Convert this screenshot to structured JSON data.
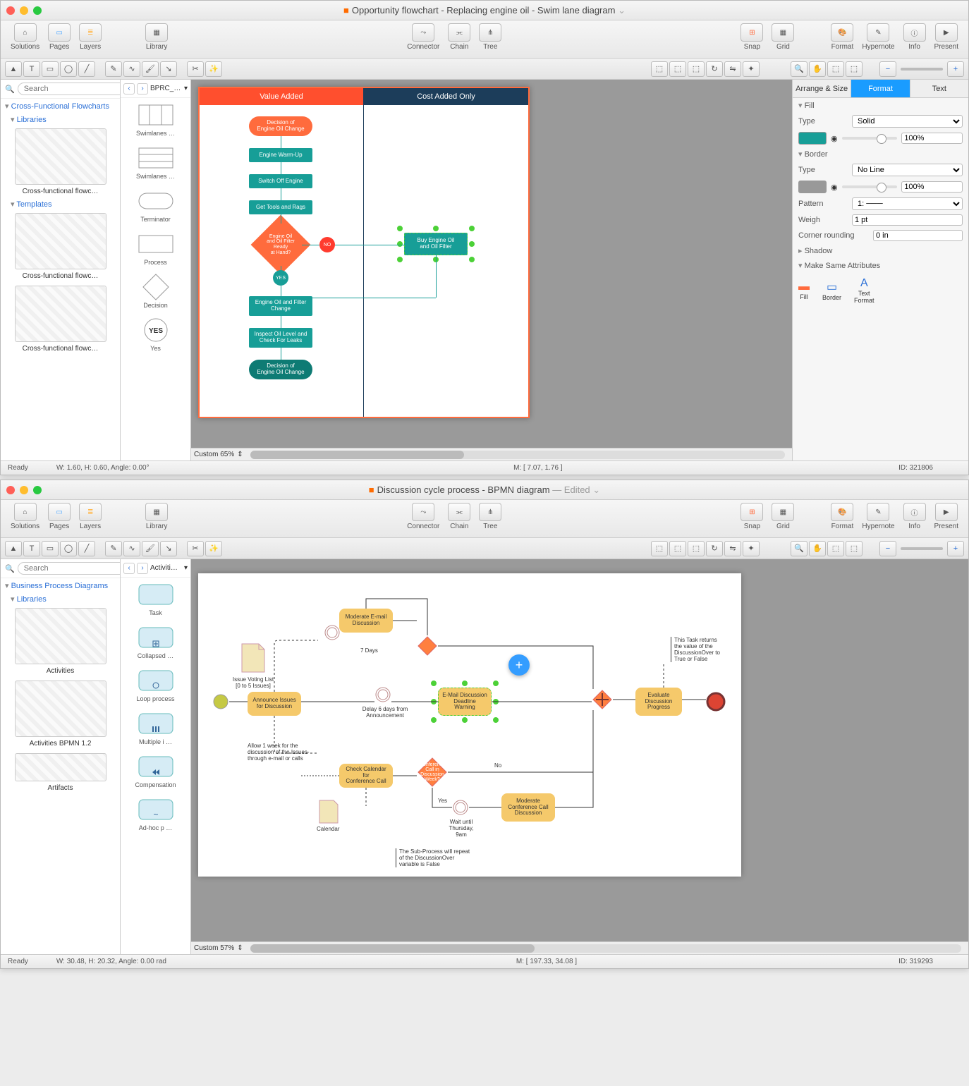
{
  "win1": {
    "title": "Opportunity flowchart - Replacing engine oil - Swim lane diagram",
    "toolbar": [
      "Solutions",
      "Pages",
      "Layers",
      "Library",
      "Connector",
      "Chain",
      "Tree",
      "Snap",
      "Grid",
      "Format",
      "Hypernote",
      "Info",
      "Present"
    ],
    "search_ph": "Search",
    "sidebar": {
      "section": "Cross-Functional Flowcharts",
      "libs": "Libraries",
      "tmpls": "Templates",
      "items": [
        "Cross-functional flowc…",
        "Cross-functional flowc…",
        "Cross-functional flowc…"
      ]
    },
    "shapes_crumb": "BPRC_…",
    "shapes": [
      "Swimlanes …",
      "Swimlanes …",
      "Terminator",
      "Process",
      "Decision",
      "Yes"
    ],
    "lanes": [
      "Value Added",
      "Cost Added Only"
    ],
    "nodes": {
      "n1": "Decision of\nEngine Oil Change",
      "n2": "Engine Warm-Up",
      "n3": "Switch Off Engine",
      "n4": "Get Tools and Rags",
      "n5": "Engine Oil\nand Oil Filter Ready\nat Hand?",
      "no": "NO",
      "yes": "YES",
      "n6": "Buy Engine Oil\nand Oil Filter",
      "n7": "Engine Oil and Filter\nChange",
      "n8": "Inspect Oil Level and\nCheck For Leaks",
      "n9": "Decision of\nEngine Oil Change"
    },
    "zoom": "Custom 65%",
    "insp": {
      "tabs": [
        "Arrange & Size",
        "Format",
        "Text"
      ],
      "fill": "Fill",
      "type": "Type",
      "solid": "Solid",
      "pct": "100%",
      "border": "Border",
      "noline": "No Line",
      "pattern": "Pattern",
      "weigh": "Weigh",
      "wval": "1 pt",
      "corner": "Corner rounding",
      "cval": "0 in",
      "shadow": "Shadow",
      "same": "Make Same Attributes",
      "sfill": "Fill",
      "sborder": "Border",
      "stext": "Text\nFormat"
    },
    "status": {
      "ready": "Ready",
      "wh": "W: 1.60,  H: 0.60,  Angle: 0.00°",
      "m": "M: [ 7.07, 1.76 ]",
      "id": "ID: 321806"
    }
  },
  "win2": {
    "title": "Discussion cycle process - BPMN diagram",
    "edited": "— Edited",
    "toolbar": [
      "Solutions",
      "Pages",
      "Layers",
      "Library",
      "Connector",
      "Chain",
      "Tree",
      "Snap",
      "Grid",
      "Format",
      "Hypernote",
      "Info",
      "Present"
    ],
    "sidebar": {
      "section": "Business Process Diagrams",
      "libs": "Libraries",
      "items": [
        "Activities",
        "Activities BPMN 1.2",
        "Artifacts"
      ]
    },
    "shapes_crumb": "Activiti…",
    "shapes": [
      "Task",
      "Collapsed …",
      "Loop process",
      "Multiple i …",
      "Compensation",
      "Ad-hoc p …"
    ],
    "nodes": {
      "a1": "Issue Voting List\n[0 to 5 Issues]",
      "a2": "Announce Issues\nfor Discussion",
      "a3": "Moderate E-mail\nDiscussion",
      "a4": "7 Days",
      "a5": "Delay 6 days from\nAnnouncement",
      "a6": "E-Mail Discussion\nDeadline\nWarning",
      "a7": "Allow 1 week for the\ndiscussion of the Issues-\nthrough e-mail or calls",
      "a8": "Check Calendar for\nConference Call",
      "a9": "Conference\nCall in Discussion\nWeek?",
      "a10": "Yes",
      "a11": "No",
      "a12": "Wait until\nThursday, 9am",
      "a13": "Moderate\nConference Call\nDiscussion",
      "a14": "Evaluate\nDiscussion\nProgress",
      "a15": "This Task returns\nthe value of the\nDiscussionOver to\nTrue or False",
      "a16": "Calendar",
      "a17": "The Sub-Process will repeat\nof the DiscussionOver\nvariable is False"
    },
    "zoom": "Custom 57%",
    "status": {
      "ready": "Ready",
      "wh": "W: 30.48,  H: 20.32,  Angle: 0.00 rad",
      "m": "M: [ 197.33, 34.08 ]",
      "id": "ID: 319293"
    }
  }
}
